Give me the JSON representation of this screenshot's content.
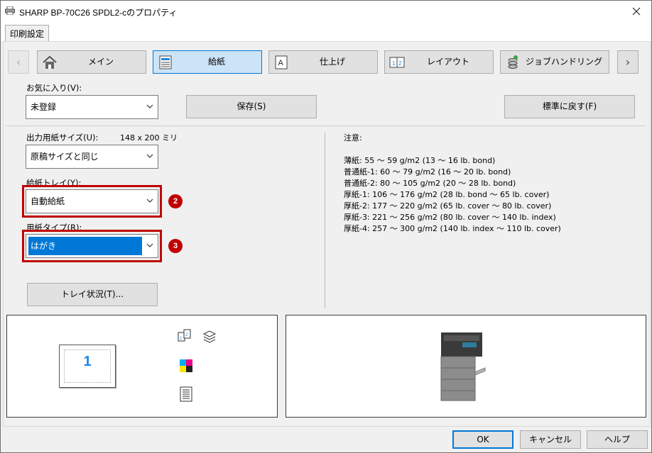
{
  "window": {
    "title": "SHARP BP-70C26 SPDL2-cのプロパティ"
  },
  "tabs": [
    {
      "label": "印刷設定"
    }
  ],
  "nav": {
    "items": [
      {
        "label": "メイン",
        "icon": "home-icon",
        "active": false
      },
      {
        "label": "給紙",
        "icon": "paper-feed-icon",
        "active": true
      },
      {
        "label": "仕上げ",
        "icon": "finishing-icon",
        "active": false
      },
      {
        "label": "レイアウト",
        "icon": "layout-icon",
        "active": false
      },
      {
        "label": "ジョブハンドリング",
        "icon": "job-handling-icon",
        "active": false
      }
    ]
  },
  "favorites": {
    "label": "お気に入り(V):",
    "value": "未登録",
    "save_label": "保存(S)",
    "reset_label": "標準に戻す(F)"
  },
  "output_size": {
    "label": "出力用紙サイズ(U):",
    "dimension": "148 x 200 ミリ",
    "value": "原稿サイズと同じ"
  },
  "paper_tray": {
    "label": "給紙トレイ(Y):",
    "value": "自動給紙",
    "badge": "2"
  },
  "paper_type": {
    "label": "用紙タイプ(R):",
    "value": "はがき",
    "badge": "3"
  },
  "tray_status_label": "トレイ状況(T)...",
  "notes": {
    "title": "注意:",
    "lines": [
      "薄紙: 55 〜 59 g/m2 (13 〜 16 lb. bond)",
      "普通紙-1: 60 〜 79 g/m2 (16 〜 20 lb. bond)",
      "普通紙-2: 80 〜 105 g/m2 (20 〜 28 lb. bond)",
      "厚紙-1: 106 〜 176 g/m2 (28 lb. bond 〜 65 lb. cover)",
      "厚紙-2: 177 〜 220 g/m2 (65 lb. cover 〜 80 lb. cover)",
      "厚紙-3: 221 〜 256 g/m2 (80 lb. cover 〜 140 lb. index)",
      "厚紙-4: 257 〜 300 g/m2 (140 lb. index 〜 110 lb. cover)"
    ]
  },
  "preview": {
    "page_number": "1"
  },
  "buttons": {
    "ok": "OK",
    "cancel": "キャンセル",
    "help": "ヘルプ"
  },
  "colors": {
    "accent": "#0078d7",
    "highlight": "#c00000",
    "active_nav": "#cce4f7"
  }
}
